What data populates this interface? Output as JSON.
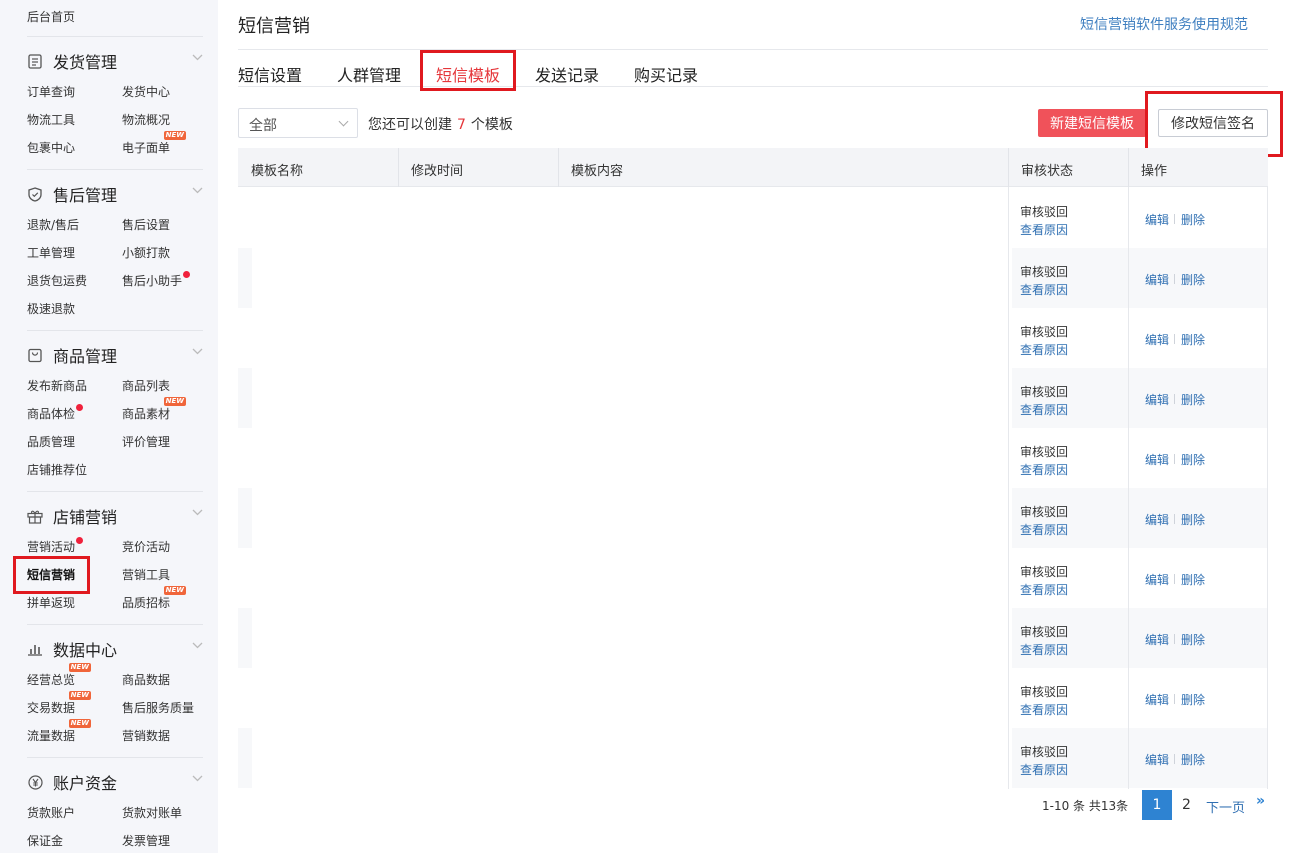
{
  "sidebar": {
    "home": "后台首页",
    "groups": [
      {
        "title": "发货管理",
        "icon": "document-icon",
        "items": [
          "订单查询",
          "发货中心",
          "物流工具",
          "物流概况",
          "包裹中心",
          "电子面单"
        ]
      },
      {
        "title": "售后管理",
        "icon": "shield-icon",
        "items": [
          "退款/售后",
          "售后设置",
          "工单管理",
          "小额打款",
          "退货包运费",
          "售后小助手",
          "极速退款"
        ]
      },
      {
        "title": "商品管理",
        "icon": "bag-icon",
        "items": [
          "发布新商品",
          "商品列表",
          "商品体检",
          "商品素材",
          "品质管理",
          "评价管理",
          "店铺推荐位"
        ]
      },
      {
        "title": "店铺营销",
        "icon": "gift-icon",
        "items": [
          "营销活动",
          "竞价活动",
          "短信营销",
          "营销工具",
          "拼单返现",
          "品质招标"
        ]
      },
      {
        "title": "数据中心",
        "icon": "bar-chart-icon",
        "items": [
          "经营总览",
          "商品数据",
          "交易数据",
          "售后服务质量",
          "流量数据",
          "营销数据"
        ]
      },
      {
        "title": "账户资金",
        "icon": "yen-icon",
        "items": [
          "货款账户",
          "货款对账单",
          "保证金",
          "发票管理"
        ]
      }
    ],
    "new_badge": "NEW"
  },
  "header": {
    "title": "短信营销",
    "help_link": "短信营销软件服务使用规范"
  },
  "tabs": [
    "短信设置",
    "人群管理",
    "短信模板",
    "发送记录",
    "购买记录"
  ],
  "active_tab": "短信模板",
  "toolbar": {
    "filter_value": "全部",
    "quota_prefix": "您还可以创建",
    "quota_count": "7",
    "quota_suffix": "个模板",
    "new_button": "新建短信模板",
    "sign_button": "修改短信签名"
  },
  "table": {
    "columns": [
      "模板名称",
      "修改时间",
      "模板内容",
      "审核状态",
      "操作"
    ],
    "rows": [
      {
        "status": "审核驳回",
        "reason": "查看原因",
        "edit": "编辑",
        "delete": "删除"
      },
      {
        "status": "审核驳回",
        "reason": "查看原因",
        "edit": "编辑",
        "delete": "删除"
      },
      {
        "status": "审核驳回",
        "reason": "查看原因",
        "edit": "编辑",
        "delete": "删除"
      },
      {
        "status": "审核驳回",
        "reason": "查看原因",
        "edit": "编辑",
        "delete": "删除"
      },
      {
        "status": "审核驳回",
        "reason": "查看原因",
        "edit": "编辑",
        "delete": "删除"
      },
      {
        "status": "审核驳回",
        "reason": "查看原因",
        "edit": "编辑",
        "delete": "删除"
      },
      {
        "status": "审核驳回",
        "reason": "查看原因",
        "edit": "编辑",
        "delete": "删除"
      },
      {
        "status": "审核驳回",
        "reason": "查看原因",
        "edit": "编辑",
        "delete": "删除"
      },
      {
        "status": "审核驳回",
        "reason": "查看原因",
        "edit": "编辑",
        "delete": "删除"
      },
      {
        "status": "审核驳回",
        "reason": "查看原因",
        "edit": "编辑",
        "delete": "删除"
      }
    ]
  },
  "pagination": {
    "info": "1-10 条 共13条",
    "pages": [
      "1",
      "2"
    ],
    "current": "1",
    "next": "下一页",
    "last_icon": "»"
  },
  "colors": {
    "accent_red": "#e5363a",
    "link_blue": "#2f6fb2",
    "primary_blue": "#2e83d2",
    "new_button_bg": "#f0525a"
  }
}
